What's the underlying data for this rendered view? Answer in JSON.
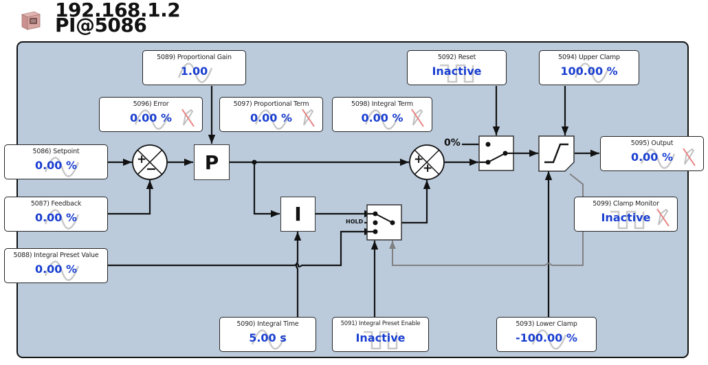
{
  "header": {
    "ip_address": "192.168.1.2",
    "block_name": "PI@5086",
    "icon": "ethernet-port-icon"
  },
  "colors": {
    "panel_background": "#bbcbdc",
    "value_text": "#1a3fd0",
    "wire": "#111111",
    "monitor_wire": "#808080",
    "no_write_mark": "#e8807f"
  },
  "params": {
    "setpoint": {
      "label": "5086) Setpoint",
      "value": "0.00 %",
      "icon": "analog-wave-icon"
    },
    "feedback": {
      "label": "5087) Feedback",
      "value": "0.00 %",
      "icon": "analog-wave-icon"
    },
    "integral_preset_value": {
      "label": "5088) Integral Preset Value",
      "value": "0.00 %",
      "icon": "analog-wave-icon"
    },
    "proportional_gain": {
      "label": "5089) Proportional Gain",
      "value": "1.00",
      "icon": "analog-wave-icon"
    },
    "integral_time": {
      "label": "5090) Integral Time",
      "value": "5.00 s",
      "icon": "analog-wave-icon"
    },
    "integral_preset_enable": {
      "label": "5091) Integral Preset Enable",
      "value": "Inactive",
      "icon": "digital-pulse-icon"
    },
    "reset": {
      "label": "5092) Reset",
      "value": "Inactive",
      "icon": "digital-pulse-icon"
    },
    "lower_clamp": {
      "label": "5093) Lower Clamp",
      "value": "-100.00 %",
      "icon": "analog-wave-icon"
    },
    "upper_clamp": {
      "label": "5094) Upper Clamp",
      "value": "100.00 %",
      "icon": "analog-wave-icon"
    },
    "output": {
      "label": "5095) Output",
      "value": "0.00 %",
      "icon": "analog-wave-icon",
      "read_only": true
    },
    "error": {
      "label": "5096) Error",
      "value": "0.00 %",
      "icon": "analog-wave-icon",
      "read_only": true
    },
    "proportional_term": {
      "label": "5097) Proportional Term",
      "value": "0.00 %",
      "icon": "analog-wave-icon",
      "read_only": true
    },
    "integral_term": {
      "label": "5098) Integral Term",
      "value": "0.00 %",
      "icon": "analog-wave-icon",
      "read_only": true
    },
    "clamp_monitor": {
      "label": "5099) Clamp Monitor",
      "value": "Inactive",
      "icon": "digital-pulse-icon",
      "read_only": true
    }
  },
  "blocks": {
    "proportional": "P",
    "integral": "I",
    "reset_zero_label": "0%",
    "hold_label": "HOLD",
    "sum1_signs": [
      "+",
      "−"
    ],
    "sum2_signs": [
      "+",
      "+"
    ]
  }
}
